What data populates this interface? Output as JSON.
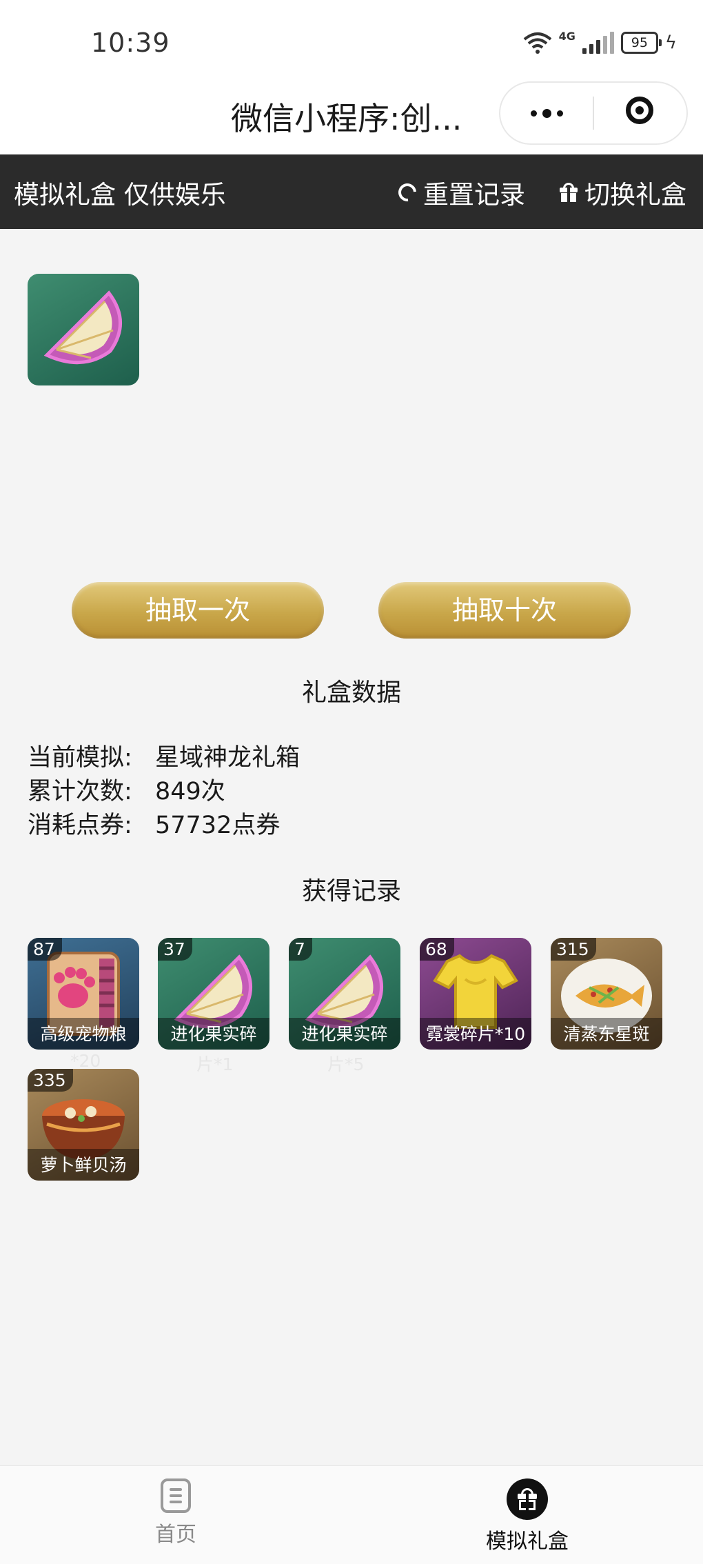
{
  "status_bar": {
    "time": "10:39",
    "network": "4G",
    "battery": "95"
  },
  "nav": {
    "title": "微信小程序:创..."
  },
  "topbar": {
    "title": "模拟礼盒 仅供娱乐",
    "reset_label": "重置记录",
    "switch_label": "切换礼盒"
  },
  "result_item": {
    "icon": "evolution-fruit-shard"
  },
  "buttons": {
    "draw_once": "抽取一次",
    "draw_ten": "抽取十次"
  },
  "stats": {
    "title": "礼盒数据",
    "current_label": "当前模拟:",
    "current_value": "星域神龙礼箱",
    "count_label": "累计次数:",
    "count_value": "849次",
    "cost_label": "消耗点券:",
    "cost_value": "57732点券"
  },
  "records": {
    "title": "获得记录",
    "items": [
      {
        "count": "87",
        "name": "高级宠物粮",
        "overflow": "*20",
        "icon": "pet-food-bag"
      },
      {
        "count": "37",
        "name": "进化果实碎",
        "overflow": "片*1",
        "icon": "evolution-fruit-shard"
      },
      {
        "count": "7",
        "name": "进化果实碎",
        "overflow": "片*5",
        "icon": "evolution-fruit-shard"
      },
      {
        "count": "68",
        "name": "霓裳碎片*10",
        "overflow": "",
        "icon": "costume-shard-shirt"
      },
      {
        "count": "315",
        "name": "清蒸东星斑",
        "overflow": "",
        "icon": "steamed-fish-dish"
      },
      {
        "count": "335",
        "name": "萝卜鲜贝汤",
        "overflow": "",
        "icon": "radish-scallop-soup"
      }
    ]
  },
  "tabbar": {
    "home_label": "首页",
    "gift_label": "模拟礼盒"
  }
}
